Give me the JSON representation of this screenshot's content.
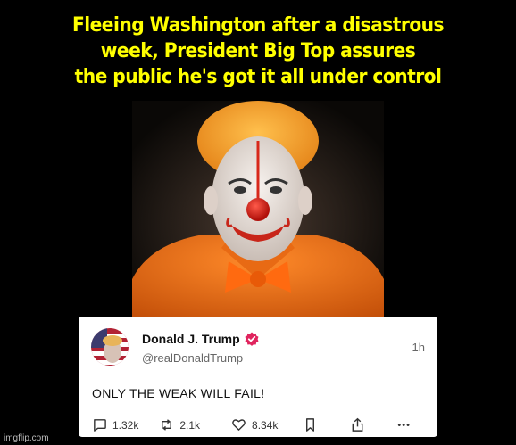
{
  "caption": {
    "line1": "Fleeing Washington after a disastrous",
    "line2": "week, President Big Top assures",
    "line3": "the public he's got it all under control"
  },
  "post": {
    "display_name": "Donald J. Trump",
    "handle": "@realDonaldTrump",
    "time": "1h",
    "text": "ONLY THE WEAK WILL FAIL!",
    "replies": "1.32k",
    "reposts": "2.1k",
    "likes": "8.34k",
    "more": "•••",
    "verified_color": "#e0245e"
  },
  "watermark": "imgflip.com",
  "colors": {
    "background": "#000000",
    "caption": "#ffff00",
    "card": "#ffffff"
  },
  "icons": [
    "verified-badge-icon",
    "reply-icon",
    "repost-icon",
    "like-icon",
    "bookmark-icon",
    "share-icon",
    "more-icon"
  ]
}
